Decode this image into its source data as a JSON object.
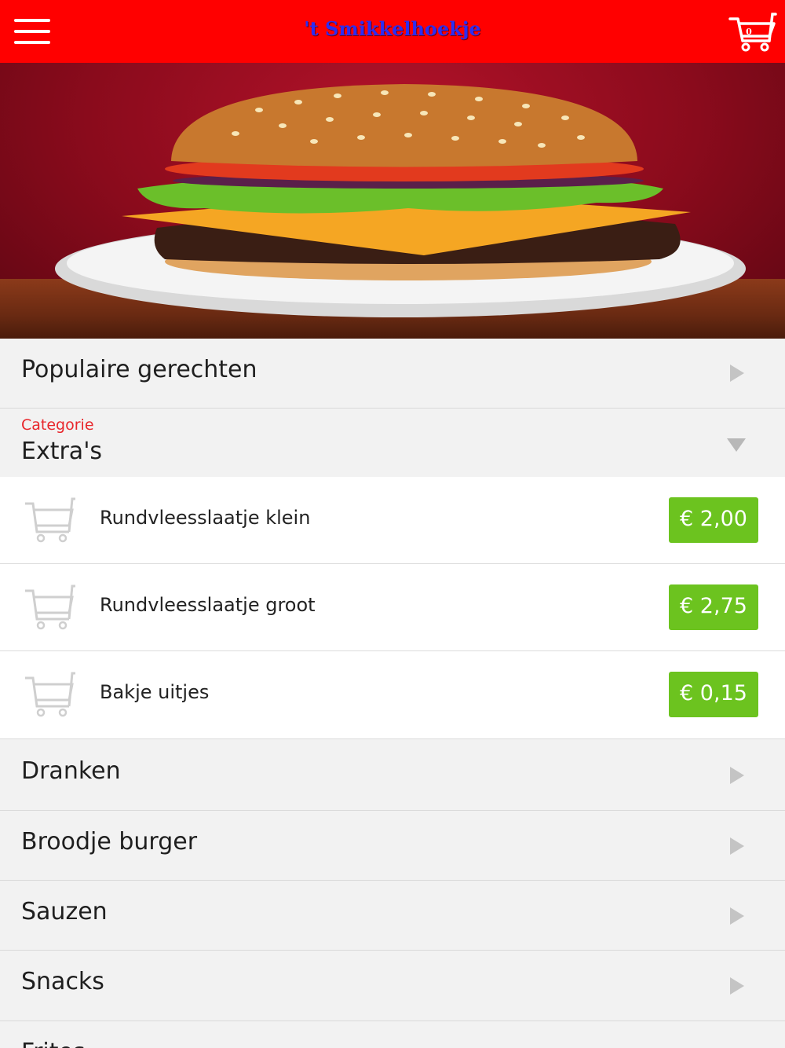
{
  "header": {
    "title": "'t Smikkelhoekje",
    "cart_count": "0",
    "menu_icon": "hamburger-menu-icon",
    "cart_icon": "shopping-cart-icon",
    "background_color": "#ff0000"
  },
  "hero": {
    "image": "burger-photo"
  },
  "categories": {
    "popular": {
      "label": "Populaire gerechten"
    },
    "expanded": {
      "caption": "Categorie",
      "label": "Extra's",
      "items": [
        {
          "name": "Rundvleesslaatje klein",
          "price": "€ 2,00"
        },
        {
          "name": "Rundvleesslaatje groot",
          "price": "€ 2,75"
        },
        {
          "name": "Bakje uitjes",
          "price": "€ 0,15"
        }
      ]
    },
    "list": [
      {
        "label": "Dranken"
      },
      {
        "label": "Broodje burger"
      },
      {
        "label": "Sauzen"
      },
      {
        "label": "Snacks"
      },
      {
        "label": "Frites"
      }
    ]
  },
  "colors": {
    "accent_red": "#ff0000",
    "caption_red": "#e8262b",
    "price_green": "#6cc31f",
    "title_blue": "#2d2df2"
  }
}
